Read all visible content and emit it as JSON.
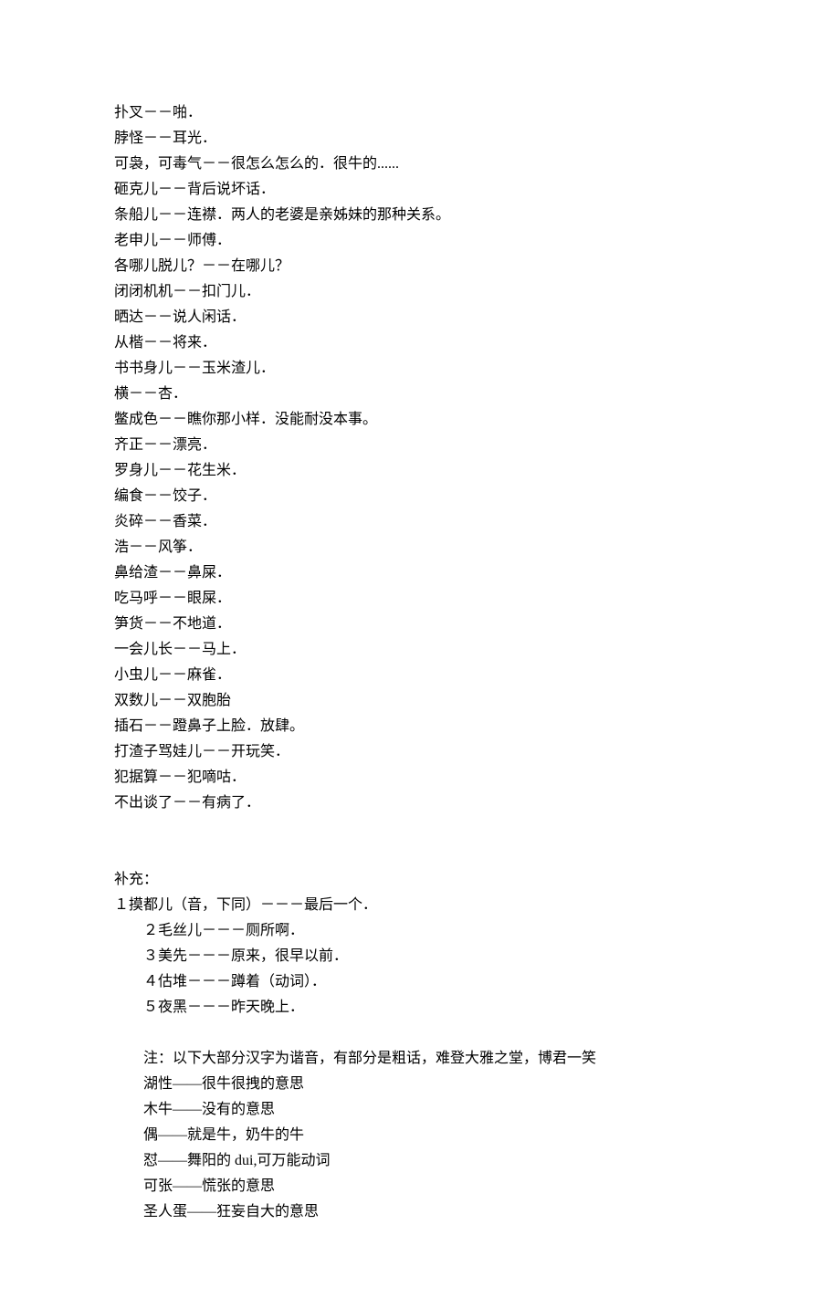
{
  "lines": [
    "扑叉－－啪．",
    "脖怪－－耳光．",
    "可袅，可毒气－－很怎么怎么的．很牛的......",
    "砸克儿－－背后说坏话．",
    "条船儿－－连襟．两人的老婆是亲姊妹的那种关系。",
    "老申儿－－师傅．",
    "各哪儿脱儿？－－在哪儿？",
    "闭闭机机－－扣门儿．",
    "晒达－－说人闲话．",
    "从楷－－将来．",
    "书书身儿－－玉米渣儿．",
    "横－－杏．",
    "鳖成色－－瞧你那小样．没能耐没本事。",
    "齐正－－漂亮．",
    "罗身儿－－花生米．",
    "编食－－饺子．",
    "炎碎－－香菜．",
    "浩－－风筝．",
    "鼻给渣－－鼻屎．",
    "吃马呼－－眼屎．",
    "笋货－－不地道．",
    "一会儿长－－马上．",
    "小虫儿－－麻雀．",
    "双数儿－－双胞胎",
    "插石－－蹬鼻子上脸．放肆。",
    "打渣子骂娃儿－－开玩笑．",
    "犯据算－－犯嘀咕．",
    "不出谈了－－有病了．"
  ],
  "supplement": {
    "title": "补充：",
    "items": [
      "１摸都儿（音，下同）－－－最后一个．",
      "２毛丝儿－－－厕所啊．",
      "３美先－－－原来，很早以前．",
      "４估堆－－－蹲着（动词）．",
      "５夜黑－－－昨天晚上．"
    ],
    "note": "注：以下大部分汉字为谐音，有部分是粗话，难登大雅之堂，博君一笑",
    "more": [
      "湖性——很牛很拽的意思",
      "木牛——没有的意思",
      "偶——就是牛，奶牛的牛",
      "怼——舞阳的 dui,可万能动词",
      "可张——慌张的意思",
      "圣人蛋——狂妄自大的意思"
    ]
  }
}
